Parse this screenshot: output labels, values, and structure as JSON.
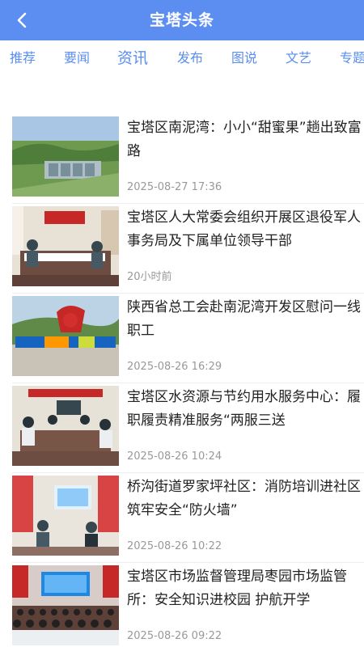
{
  "header": {
    "title": "宝塔头条",
    "back_icon": "chevron-left-icon",
    "background": "#5b8ef0"
  },
  "tabs": [
    {
      "label": "推荐",
      "active": false
    },
    {
      "label": "要闻",
      "active": false
    },
    {
      "label": "资讯",
      "active": true
    },
    {
      "label": "发布",
      "active": false
    },
    {
      "label": "图说",
      "active": false
    },
    {
      "label": "文艺",
      "active": false
    },
    {
      "label": "专题",
      "active": false
    }
  ],
  "tab_color": "#5b8ef0",
  "news": [
    {
      "title": "宝塔区南泥湾：小小“甜蜜果”趟出致富路",
      "time": "2025-08-27 17:36"
    },
    {
      "title": "宝塔区人大常委会组织开展区退役军人事务局及下属单位领导干部",
      "time": "20小时前"
    },
    {
      "title": "陕西省总工会赴南泥湾开发区慰问一线职工",
      "time": "2025-08-26 16:29"
    },
    {
      "title": "宝塔区水资源与节约用水服务中心：履职履责精准服务“两服三送",
      "time": "2025-08-26 10:24"
    },
    {
      "title": "桥沟街道罗家坪社区：消防培训进社区 筑牢安全“防火墙”",
      "time": "2025-08-26 10:22"
    },
    {
      "title": "宝塔区市场监督管理局枣园市场监管所：安全知识进校园 护航开学",
      "time": "2025-08-26 09:22"
    }
  ]
}
